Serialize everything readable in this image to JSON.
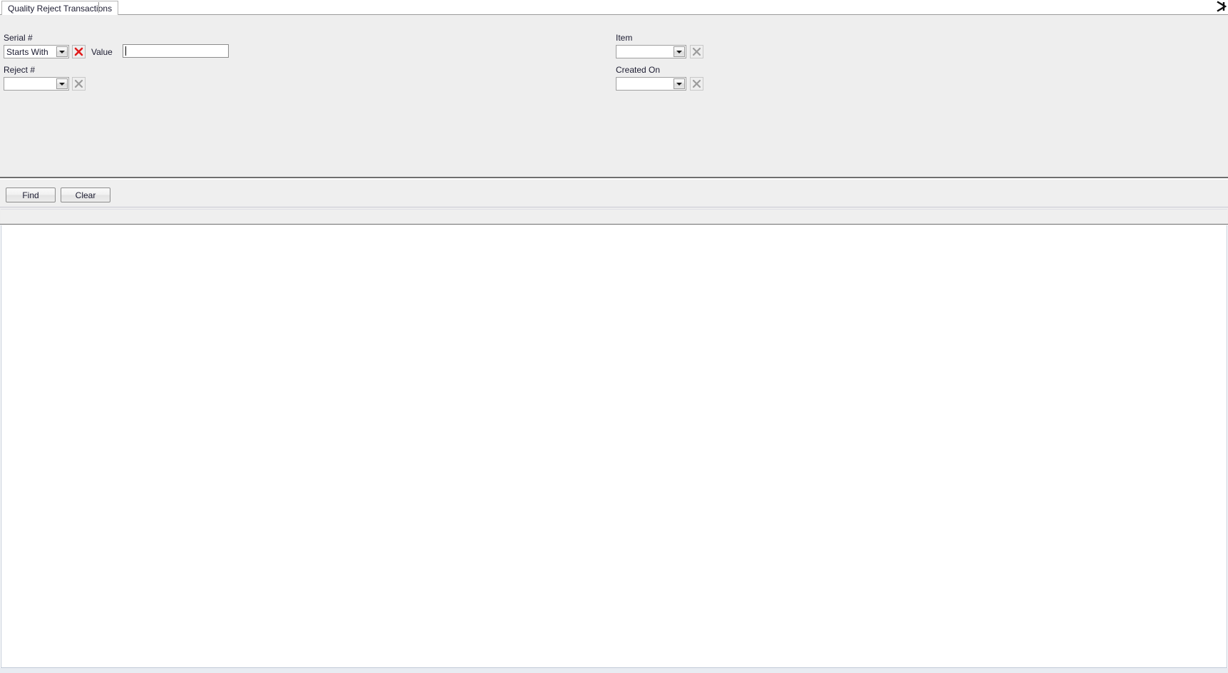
{
  "window": {
    "tab_title": "Quality Reject Transactions",
    "close_icon": "close-x-icon"
  },
  "filters": {
    "serial": {
      "label": "Serial #",
      "operator_value": "Starts With",
      "operator_icon": "chevron-down-icon",
      "clear_icon": "red-x-icon",
      "clear_enabled": true,
      "value_label": "Value",
      "value_text": "",
      "value_placeholder": ""
    },
    "reject": {
      "label": "Reject #",
      "operator_value": "",
      "operator_icon": "chevron-down-icon",
      "clear_icon": "grey-x-icon",
      "clear_enabled": false
    },
    "item": {
      "label": "Item",
      "operator_value": "",
      "operator_icon": "chevron-down-icon",
      "clear_icon": "grey-x-icon",
      "clear_enabled": false
    },
    "created_on": {
      "label": "Created On",
      "operator_value": "",
      "operator_icon": "chevron-down-icon",
      "clear_icon": "grey-x-icon",
      "clear_enabled": false
    }
  },
  "actions": {
    "find_label": "Find",
    "clear_label": "Clear"
  },
  "results": {
    "columns": [],
    "rows": [],
    "empty": true
  },
  "colors": {
    "panel_bg": "#eeeeee",
    "grid_bg": "#ffffff",
    "text": "#1b1b30",
    "clear_active": "#e01b1b",
    "clear_disabled": "#9c9c9c",
    "separator": "#6e6e6e"
  }
}
